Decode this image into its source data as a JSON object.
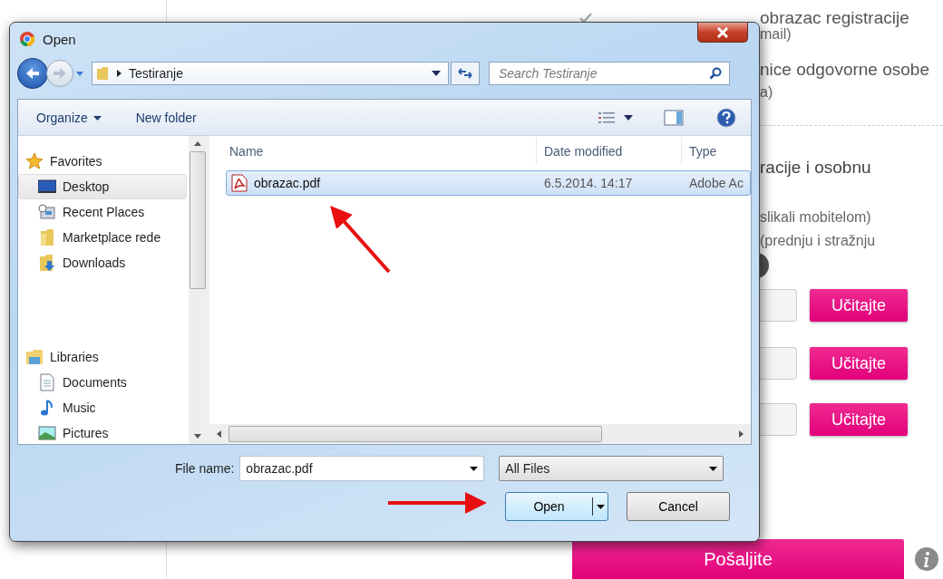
{
  "page": {
    "checked_line": {
      "checked": true,
      "text": "obrazac registracije"
    },
    "fragments": [
      "mail)",
      "nice odgovorne osobe",
      "a)"
    ],
    "heading": "racije i osobnu",
    "notes": [
      "slikali mobitelom)",
      "(prednju i stražnju"
    ],
    "upload_buttons": [
      "Učitajte",
      "Učitajte",
      "Učitajte"
    ],
    "submit": "Pošaljite"
  },
  "dialog": {
    "title": "Open",
    "path": [
      "Testiranje"
    ],
    "search": {
      "placeholder": "Search Testiranje"
    },
    "toolbar": [
      "Organize",
      "New folder"
    ],
    "nav": [
      {
        "label": "Favorites",
        "kind": "favorites",
        "selected": false,
        "children": [
          {
            "label": "Desktop",
            "kind": "desktop",
            "selected": true
          },
          {
            "label": "Recent Places",
            "kind": "recent",
            "selected": false
          },
          {
            "label": "Marketplace rede",
            "kind": "folder",
            "selected": false
          },
          {
            "label": "Downloads",
            "kind": "downloads",
            "selected": false
          }
        ]
      },
      {
        "label": "Libraries",
        "kind": "libraries",
        "selected": false,
        "children": [
          {
            "label": "Documents",
            "kind": "documents",
            "selected": false
          },
          {
            "label": "Music",
            "kind": "music",
            "selected": false
          },
          {
            "label": "Pictures",
            "kind": "pictures",
            "selected": false
          }
        ]
      }
    ],
    "columns": [
      "Name",
      "Date modified",
      "Type"
    ],
    "files": [
      {
        "name": "obrazac.pdf",
        "date": "6.5.2014. 14:17",
        "type": "Adobe Ac",
        "selected": true
      }
    ],
    "file_name_label": "File name:",
    "file_name": "obrazac.pdf",
    "filter": "All Files",
    "buttons": [
      "Open",
      "Cancel"
    ]
  }
}
